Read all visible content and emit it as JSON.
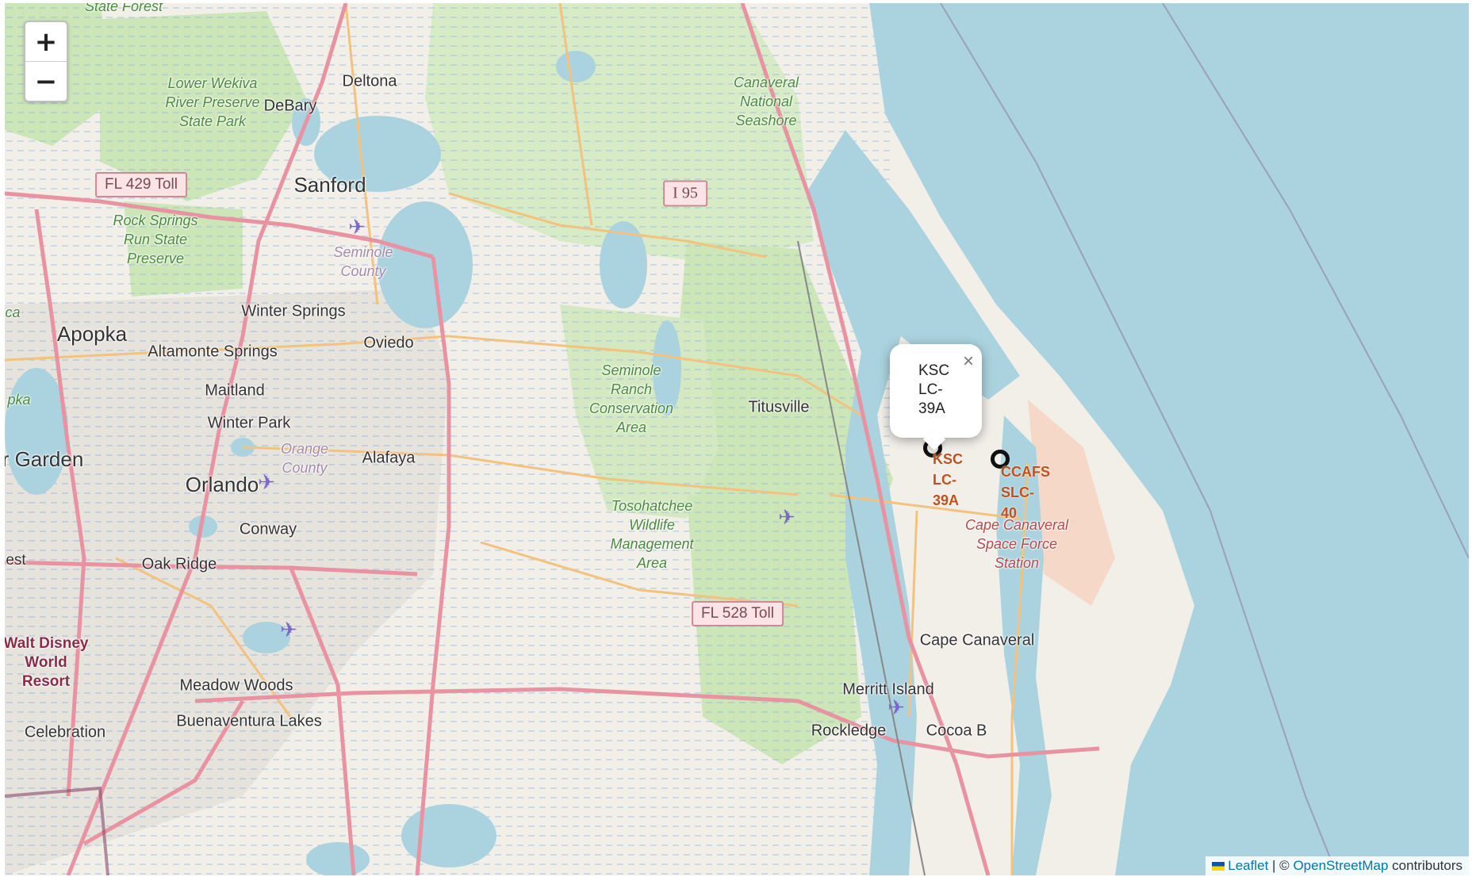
{
  "zoom": {
    "in_label": "+",
    "out_label": "−"
  },
  "places": {
    "state_forest": "State Forest",
    "lower_wekiva": "Lower Wekiva\nRiver Preserve\nState Park",
    "deltona": "Deltona",
    "debary": "DeBary",
    "sanford": "Sanford",
    "canaveral_seashore": "Canaveral\nNational\nSeashore",
    "rock_springs": "Rock Springs\nRun State\nPreserve",
    "seminole_county": "Seminole\nCounty",
    "winter_springs": "Winter Springs",
    "apopka": "Apopka",
    "altamonte": "Altamonte\nSprings",
    "oviedo": "Oviedo",
    "maitland": "Maitland",
    "winter_park": "Winter Park",
    "seminole_ranch": "Seminole\nRanch\nConservation\nArea",
    "titusville": "Titusville",
    "winter_garden": "r Garden",
    "orange_county": "Orange\nCounty",
    "alafaya": "Alafaya",
    "orlando": "Orlando",
    "tosohatchee": "Tosohatchee\nWildlife\nManagement\nArea",
    "conway": "Conway",
    "oak_ridge": "Oak Ridge",
    "est": "est",
    "pka": "pka",
    "ca": "ca",
    "cape_canaveral_sfs": "Cape Canaveral\nSpace Force\nStation",
    "cape_canaveral": "Cape Canaveral",
    "walt_disney": "Walt Disney\nWorld\nResort",
    "meadow_woods": "Meadow Woods",
    "buenaventura": "Buenaventura\nLakes",
    "merritt_island": "Merritt Island",
    "celebration": "Celebration",
    "rockledge": "Rockledge",
    "cocoa": "Cocoa B"
  },
  "shields": {
    "fl429": "FL 429 Toll",
    "i95": "I 95",
    "fl528": "FL 528 Toll"
  },
  "markers": [
    {
      "id": "ksc",
      "label": "KSC\nLC-\n39A"
    },
    {
      "id": "ccafs",
      "label": "CCAFS\nSLC-\n40"
    }
  ],
  "popup": {
    "content": "KSC\nLC-\n39A",
    "close": "×"
  },
  "attribution": {
    "leaflet": "Leaflet",
    "sep": " | © ",
    "osm": "OpenStreetMap",
    "suffix": " contributors"
  },
  "colors": {
    "water": "#aad3df",
    "land": "#f2efe9",
    "park": "#cde6b8",
    "motorway": "#e892a2",
    "primary": "#fcd6a4",
    "marker_label": "#c2501a"
  }
}
